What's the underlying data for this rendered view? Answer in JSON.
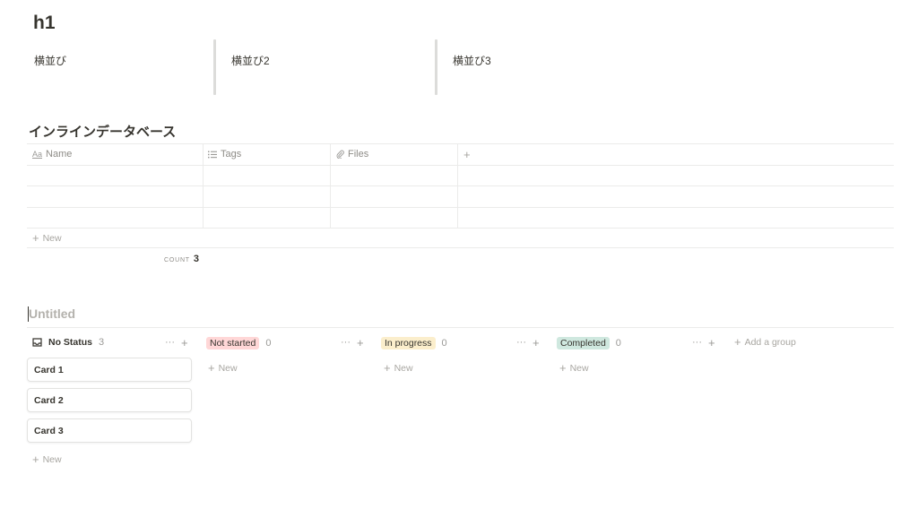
{
  "page": {
    "title": "h1"
  },
  "columns": [
    {
      "text": "横並び"
    },
    {
      "text": "横並び2"
    },
    {
      "text": "横並び3"
    }
  ],
  "inline_db": {
    "title": "インラインデータベース",
    "headers": [
      {
        "label": "Name",
        "icon": "text-aa-icon"
      },
      {
        "label": "Tags",
        "icon": "list-icon"
      },
      {
        "label": "Files",
        "icon": "paperclip-icon"
      }
    ],
    "add_column": "+",
    "new_label": "New",
    "count_label": "COUNT",
    "count_value": "3"
  },
  "board": {
    "title": "Untitled",
    "groups": [
      {
        "label": "No Status",
        "count": "3",
        "color": "",
        "icon": "inbox-icon"
      },
      {
        "label": "Not started",
        "count": "0",
        "color": "#ffd7d7"
      },
      {
        "label": "In progress",
        "count": "0",
        "color": "#fbeecc"
      },
      {
        "label": "Completed",
        "count": "0",
        "color": "#cfe8df"
      }
    ],
    "cards": [
      "Card 1",
      "Card 2",
      "Card 3"
    ],
    "new_label": "New",
    "more": "···",
    "plus": "+",
    "add_group": "Add a group"
  }
}
